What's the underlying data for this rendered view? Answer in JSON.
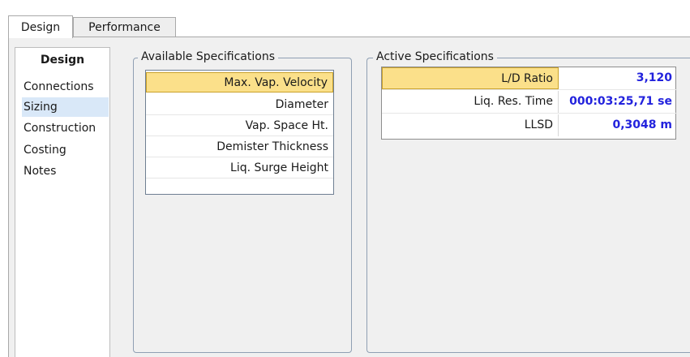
{
  "tabs": [
    {
      "label": "Design"
    },
    {
      "label": "Performance"
    }
  ],
  "nav": {
    "header": "Design",
    "items": [
      {
        "label": "Connections"
      },
      {
        "label": "Sizing"
      },
      {
        "label": "Construction"
      },
      {
        "label": "Costing"
      },
      {
        "label": "Notes"
      }
    ],
    "selected": "Sizing"
  },
  "available": {
    "legend": "Available Specifications",
    "items": [
      {
        "label": "Max. Vap. Velocity"
      },
      {
        "label": "Diameter"
      },
      {
        "label": "Vap. Space Ht."
      },
      {
        "label": "Demister Thickness"
      },
      {
        "label": "Liq. Surge Height"
      }
    ]
  },
  "active": {
    "legend": "Active Specifications",
    "rows": [
      {
        "name": "L/D Ratio",
        "value": "3,120"
      },
      {
        "name": "Liq. Res. Time",
        "value": "000:03:25,71 se"
      },
      {
        "name": "LLSD",
        "value": "0,3048 m"
      }
    ]
  },
  "colors": {
    "selection_highlight": "#fbe08a",
    "value_text": "#2222dd",
    "nav_selected": "#d9e8f8"
  }
}
